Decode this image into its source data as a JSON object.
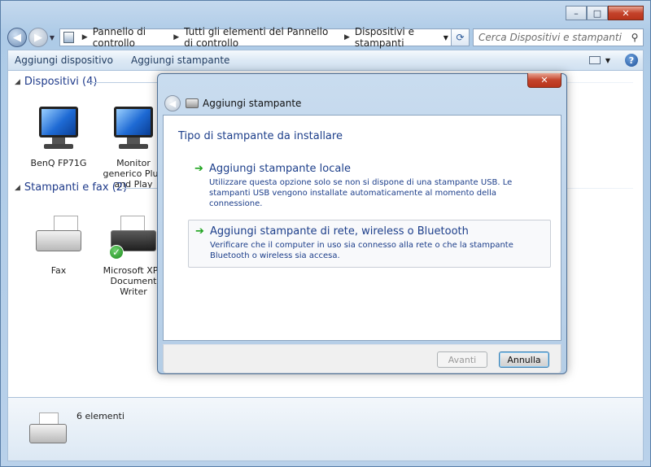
{
  "window": {
    "caption_buttons": {
      "minimize": "–",
      "maximize": "□",
      "close": "✕"
    }
  },
  "address": {
    "crumbs": [
      "Pannello di controllo",
      "Tutti gli elementi del Pannello di controllo",
      "Dispositivi e stampanti"
    ],
    "search_placeholder": "Cerca Dispositivi e stampanti"
  },
  "commandbar": {
    "add_device": "Aggiungi dispositivo",
    "add_printer": "Aggiungi stampante"
  },
  "groups": {
    "devices": {
      "title": "Dispositivi (4)",
      "items": [
        {
          "label": "BenQ FP71G"
        },
        {
          "label": "Monitor generico Plug and Play"
        }
      ]
    },
    "printers": {
      "title": "Stampanti e fax (2)",
      "items": [
        {
          "label": "Fax"
        },
        {
          "label": "Microsoft XPS Document Writer"
        }
      ]
    }
  },
  "footer": {
    "count": "6 elementi"
  },
  "dialog": {
    "title": "Aggiungi stampante",
    "heading": "Tipo di stampante da installare",
    "options": [
      {
        "title": "Aggiungi stampante locale",
        "desc": "Utilizzare questa opzione solo se non si dispone di una stampante USB. Le stampanti USB vengono installate automaticamente al momento della connessione."
      },
      {
        "title": "Aggiungi stampante di rete, wireless o Bluetooth",
        "desc": "Verificare che il computer in uso sia connesso alla rete o che la stampante Bluetooth o wireless sia accesa."
      }
    ],
    "buttons": {
      "next": "Avanti",
      "cancel": "Annulla"
    }
  },
  "colors": {
    "link_blue": "#1c3e8a",
    "arrow_green": "#1ea31e",
    "frame": "#b9d1ea"
  }
}
